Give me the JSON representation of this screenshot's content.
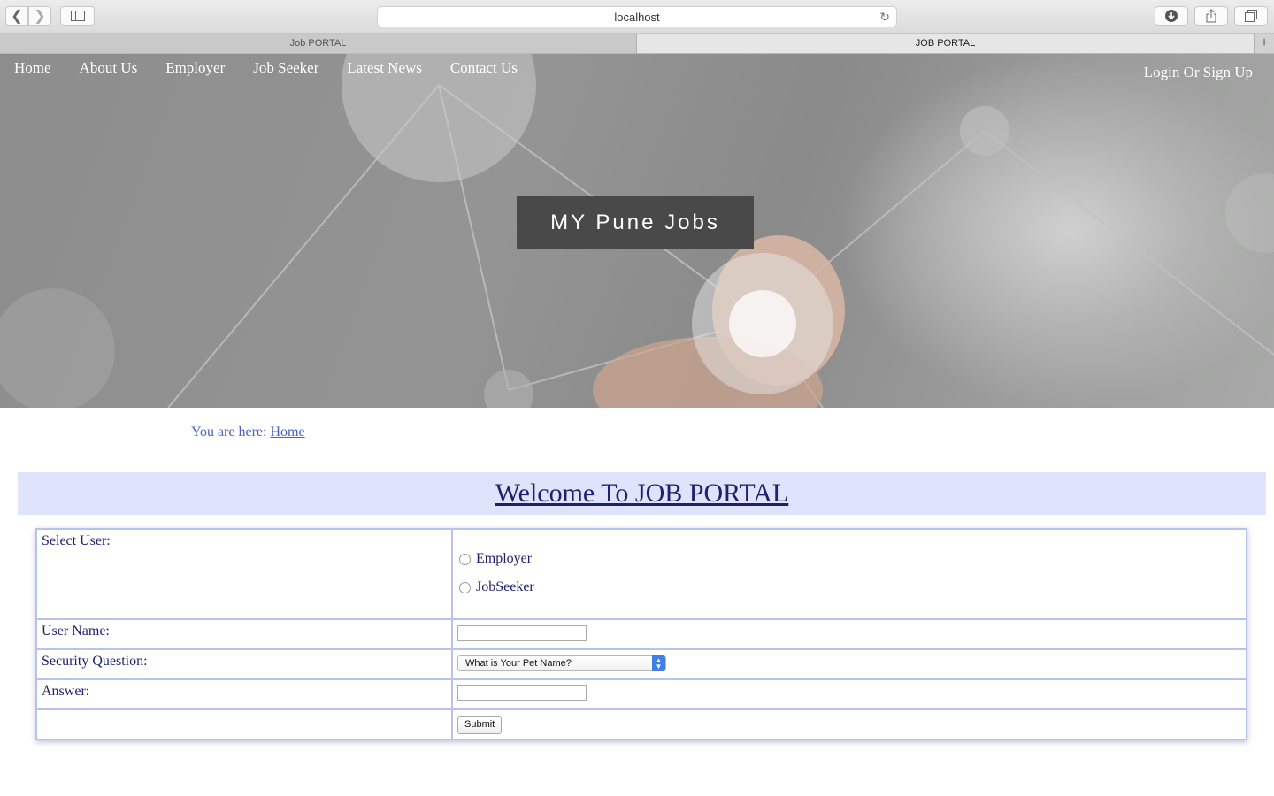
{
  "browser": {
    "url": "localhost",
    "tabs": [
      "Job PORTAL",
      "JOB PORTAL"
    ]
  },
  "nav": {
    "items": [
      "Home",
      "About Us",
      "Employer",
      "Job Seeker",
      "Latest News",
      "Contact Us"
    ],
    "login": "Login Or Sign Up"
  },
  "hero": {
    "title": "MY Pune Jobs"
  },
  "breadcrumb": {
    "prefix": "You are here:",
    "link": "Home"
  },
  "welcome": "Welcome To JOB PORTAL",
  "form": {
    "select_user_label": "Select User:",
    "options": [
      "Employer",
      "JobSeeker"
    ],
    "username_label": "User Name:",
    "username_value": "",
    "security_label": "Security Question:",
    "security_selected": "What is Your Pet Name?",
    "answer_label": "Answer:",
    "answer_value": "",
    "submit": "Submit"
  },
  "colors": {
    "accent": "#4a5fc7",
    "heading": "#1f2070",
    "welcome_bg": "#dfe3fb",
    "border": "#b6c4ec"
  }
}
